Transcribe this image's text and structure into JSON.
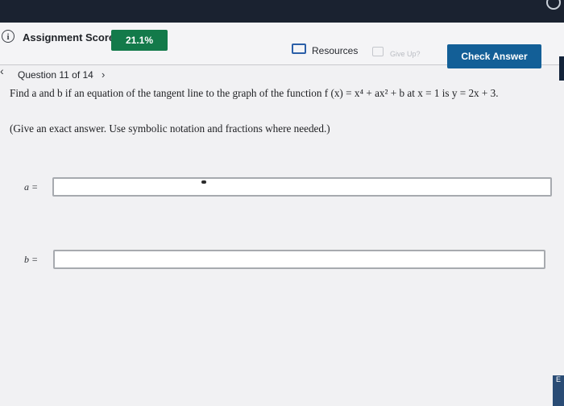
{
  "header": {
    "assignment_score_label": "Assignment Score:",
    "score_value": "21.1%",
    "resources_label": "Resources",
    "give_up_label": "Give Up?",
    "check_answer_label": "Check Answer",
    "accent_green": "#137a4a",
    "accent_blue": "#135f97"
  },
  "navigation": {
    "prev_icon": "chevron-left-icon",
    "next_icon": "chevron-right-icon",
    "question_label": "Question 11 of 14"
  },
  "question": {
    "prompt": "Find a and b if an equation of the tangent line to the graph of the function f (x) = x⁴ + ax² + b at x = 1 is y = 2x + 3.",
    "note": "(Give an exact answer. Use symbolic notation and fractions where needed.)"
  },
  "answers": [
    {
      "label": "a =",
      "value": ""
    },
    {
      "label": "b =",
      "value": ""
    }
  ],
  "edge_tab_label": "E"
}
